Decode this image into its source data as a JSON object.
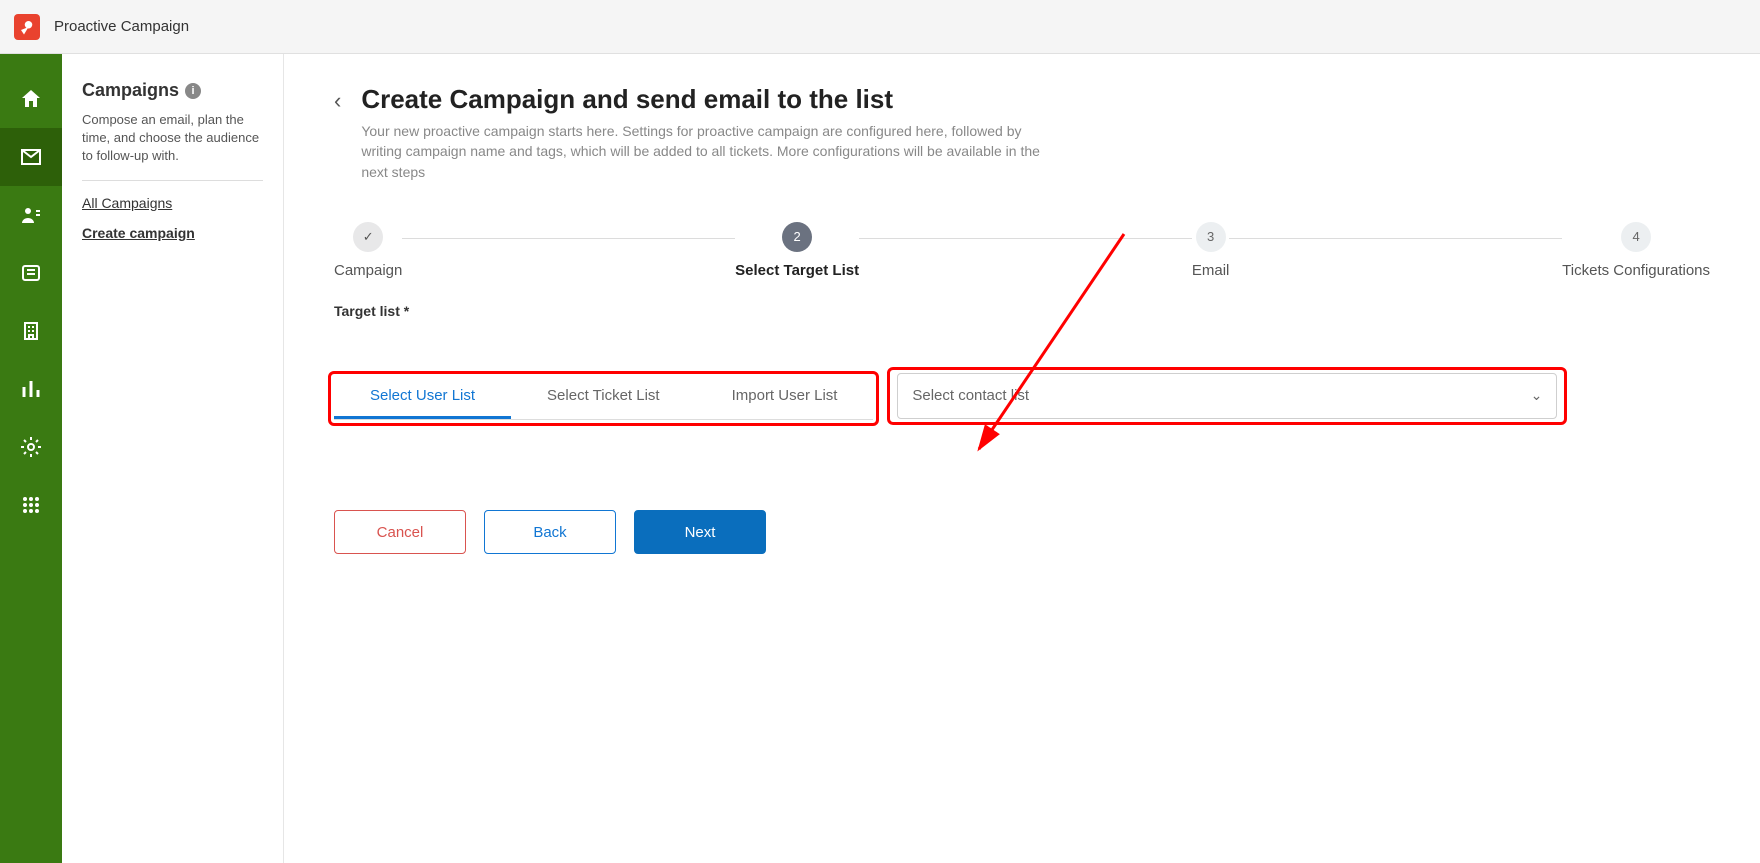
{
  "app": {
    "title": "Proactive Campaign"
  },
  "sidebar": {
    "heading": "Campaigns",
    "description": "Compose an email, plan the time, and choose the audience to follow-up with.",
    "links": {
      "all": "All Campaigns",
      "create": "Create campaign"
    }
  },
  "page": {
    "title": "Create Campaign and send email to the list",
    "description": "Your new proactive campaign starts here. Settings for proactive campaign are configured here, followed by writing campaign name and tags, which will be added to all tickets. More configurations will be available in the next steps"
  },
  "stepper": {
    "step1": {
      "icon": "✓",
      "label": "Campaign"
    },
    "step2": {
      "num": "2",
      "label": "Select Target List"
    },
    "step3": {
      "num": "3",
      "label": "Email"
    },
    "step4": {
      "num": "4",
      "label": "Tickets Configurations"
    }
  },
  "form": {
    "target_list_label": "Target list *",
    "tabs": {
      "user": "Select User List",
      "ticket": "Select Ticket List",
      "import": "Import User List"
    },
    "dropdown_placeholder": "Select contact list"
  },
  "buttons": {
    "cancel": "Cancel",
    "back": "Back",
    "next": "Next"
  }
}
